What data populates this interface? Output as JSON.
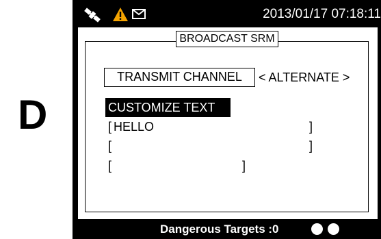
{
  "panel_letter": "D",
  "status_bar": {
    "icons": [
      "satellite-icon",
      "warning-icon",
      "mail-icon"
    ],
    "datetime": "2013/01/17 07:18:11"
  },
  "screen": {
    "title": "BROADCAST SRM",
    "transmit_channel": {
      "label": "TRANSMIT CHANNEL",
      "value": "< ALTERNATE >"
    },
    "customize_text": {
      "heading": "CUSTOMIZE TEXT",
      "lines": [
        {
          "open": "[",
          "text": "HELLO",
          "close": "]"
        },
        {
          "open": "[",
          "text": "",
          "close": "]"
        },
        {
          "open": "[",
          "text": "",
          "close": "]"
        }
      ]
    }
  },
  "footer": {
    "label": "Dangerous Targets :0",
    "indicator_count": 2
  },
  "colors": {
    "device_bg": "#000000",
    "screen_bg": "#ffffff",
    "warning": "#f4a300",
    "text_light": "#ffffff",
    "text_dark": "#000000"
  }
}
